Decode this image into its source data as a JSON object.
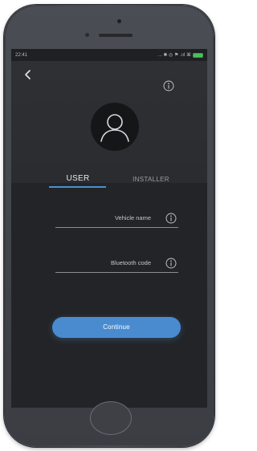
{
  "status_bar": {
    "time": "22:41",
    "icons_text": "... ✱ ◎ ⚑ .ııl ⌘",
    "battery_color": "#49c05e"
  },
  "header": {
    "back_icon": "chevron-left-icon",
    "info_icon": "info-circle-icon",
    "avatar_icon": "user-avatar-icon"
  },
  "tabs": {
    "user_label": "USER",
    "installer_label": "INSTALLER",
    "active": "USER",
    "accent_color": "#4d8fd0"
  },
  "form": {
    "vehicle_name": {
      "placeholder": "Vehicle name",
      "value": ""
    },
    "bluetooth_code": {
      "placeholder": "Bluetooth code",
      "value": ""
    }
  },
  "continue_label": "Continue",
  "button_color": "#4a8bd0"
}
